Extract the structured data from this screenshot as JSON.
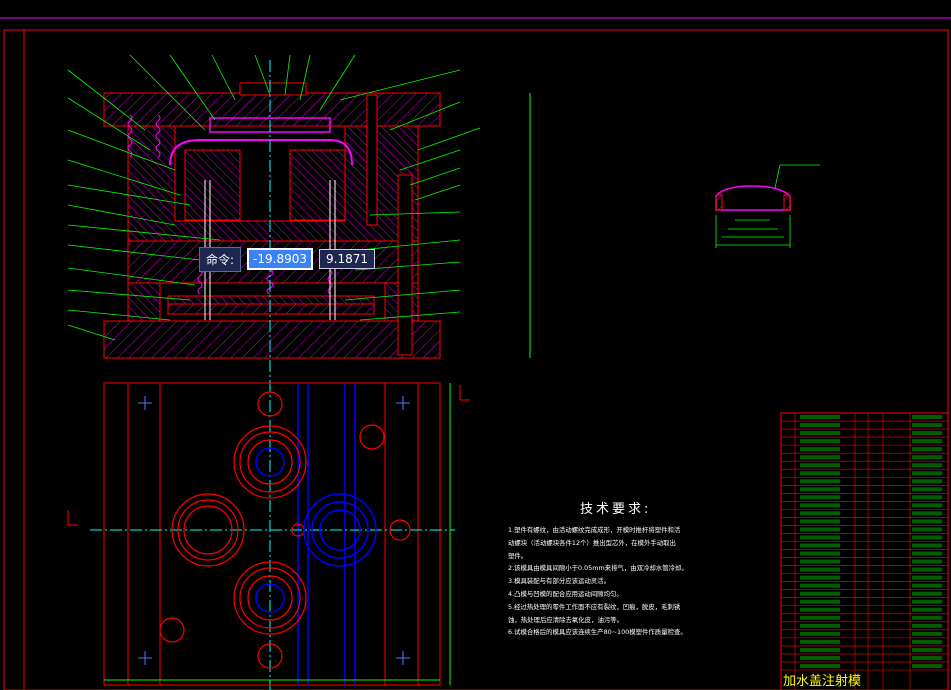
{
  "command": {
    "label": "命令:",
    "x_value": "-19.8903",
    "y_value": "9.1871"
  },
  "tech": {
    "title": "技术要求:",
    "lines": [
      "1.塑件有螺纹，由活动螺纹完成成形，开模时推杆将塑件和活",
      "  动螺块（活动螺块各件12个）推出型芯外，在模外手动取出",
      "  塑件。",
      "2.该模具由模具间隙小于0.05mm来排气，由双冷却水管冷却。",
      "3.模具装配与有部分应该运动灵活。",
      "4.凸模与凹模的配合应用运动间隙均匀。",
      "5.经过热处理的零件工作面不应有裂纹，凹痕，脱皮，毛刺锈",
      "  蚀，热处理后应清除去氧化皮，油污等。",
      "6.试模合格后的模具应该连续生产80~100模塑件作质量检查。"
    ]
  },
  "drawing_title": "加水盖注射模",
  "colors": {
    "bg": "#000000",
    "line": "#ff0000",
    "green": "#00ff00",
    "magenta": "#ff00ff",
    "blue": "#0000ff",
    "cyan": "#00ffff",
    "white": "#ffffff",
    "yellow": "#ffff00"
  }
}
